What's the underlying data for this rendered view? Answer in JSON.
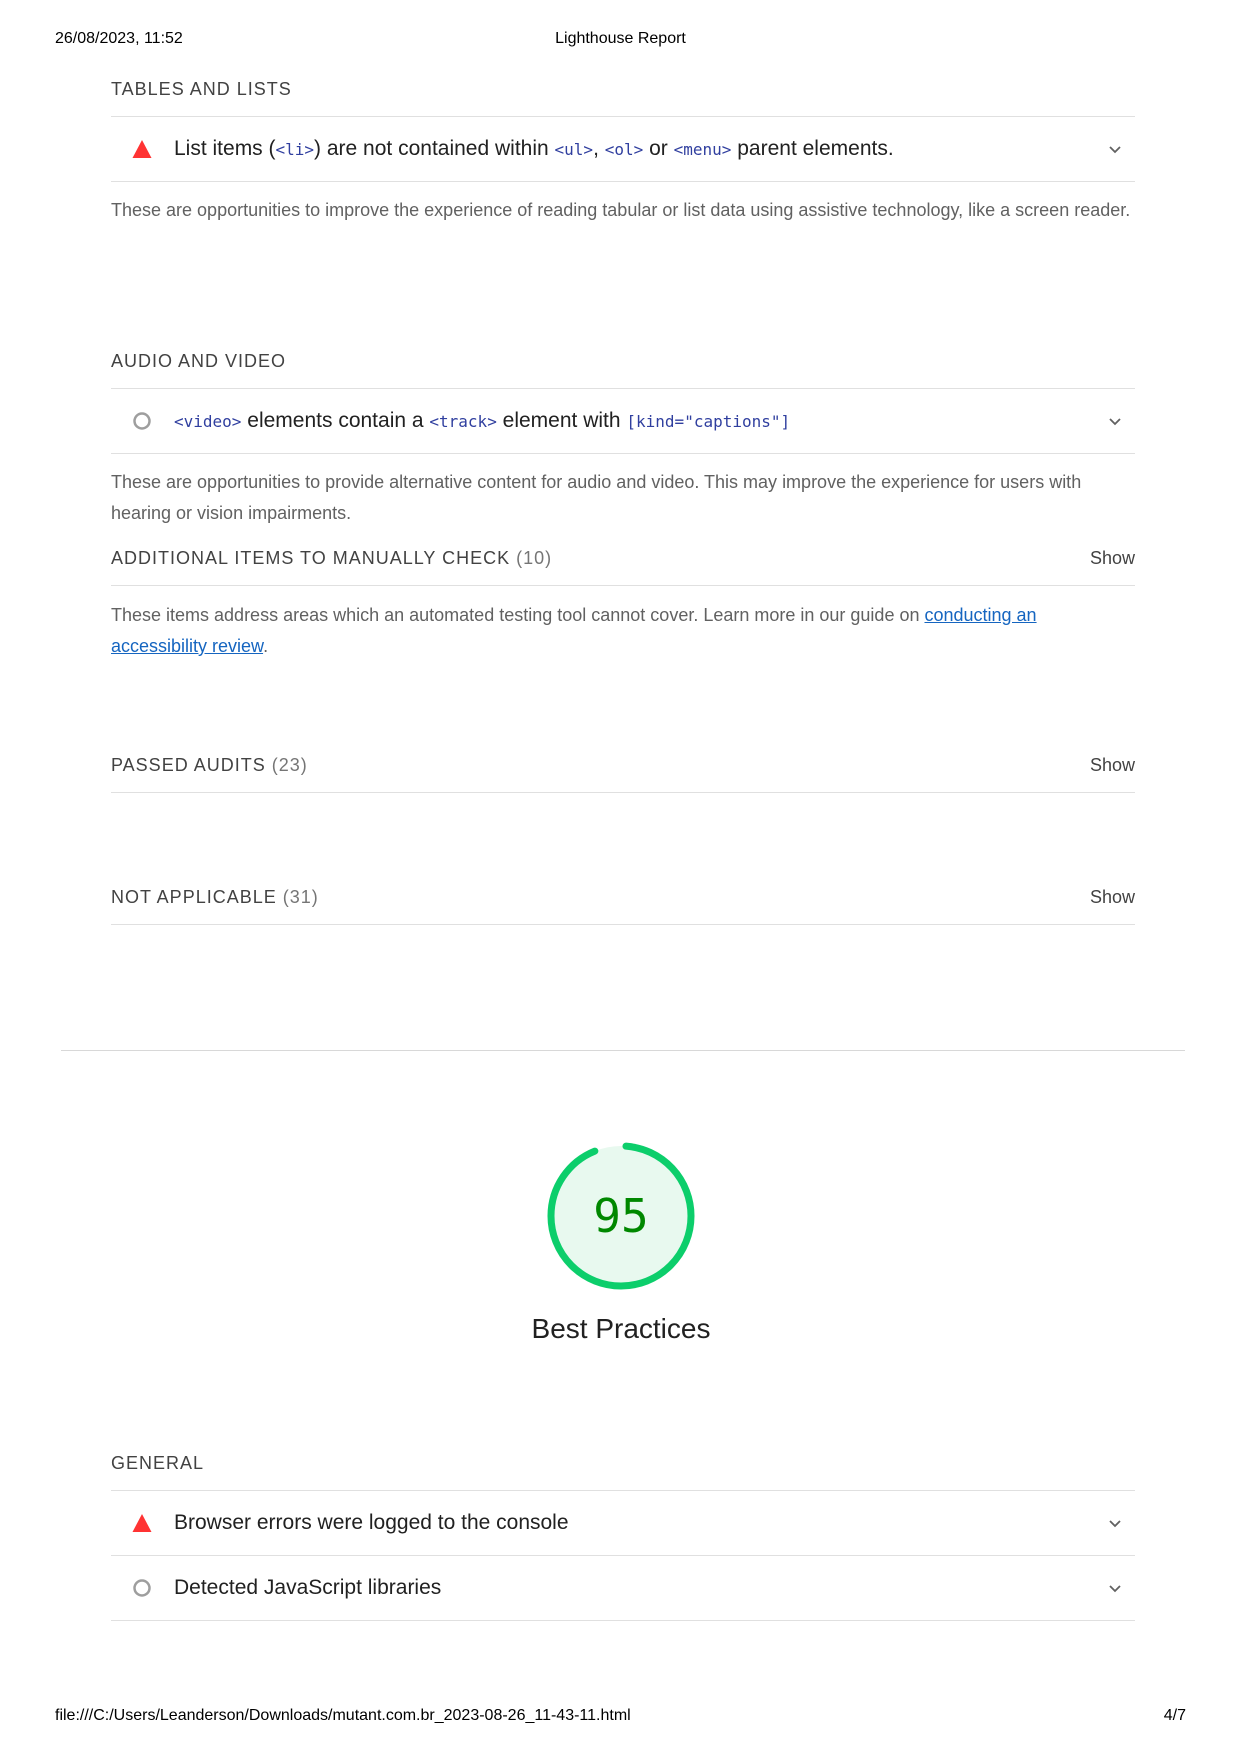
{
  "print_header": {
    "datetime": "26/08/2023, 11:52",
    "title": "Lighthouse Report"
  },
  "print_footer": {
    "path": "file:///C:/Users/Leanderson/Downloads/mutant.com.br_2023-08-26_11-43-11.html",
    "page": "4/7"
  },
  "tables_and_lists": {
    "title": "TABLES AND LISTS",
    "audit": {
      "icon": "fail-triangle-icon",
      "t1": "List items (",
      "c1": "<li>",
      "t2": ") are not contained within ",
      "c2": "<ul>",
      "t3": ", ",
      "c3": "<ol>",
      "t4": " or ",
      "c4": "<menu>",
      "t5": " parent elements."
    },
    "description": "These are opportunities to improve the experience of reading tabular or list data using assistive technology, like a screen reader."
  },
  "audio_and_video": {
    "title": "AUDIO AND VIDEO",
    "audit": {
      "icon": "informative-circle-icon",
      "c1": "<video>",
      "t1": " elements contain a ",
      "c2": "<track>",
      "t2": " element with ",
      "c3": "[kind=\"captions\"]"
    },
    "description": "These are opportunities to provide alternative content for audio and video. This may improve the experience for users with hearing or vision impairments."
  },
  "manual_check": {
    "title": "ADDITIONAL ITEMS TO MANUALLY CHECK",
    "count": "(10)",
    "show_label": "Show",
    "description_prefix": "These items address areas which an automated testing tool cannot cover. Learn more in our guide on ",
    "link_text": "conducting an accessibility review",
    "description_suffix": "."
  },
  "passed_audits": {
    "title": "PASSED AUDITS",
    "count": "(23)",
    "show_label": "Show"
  },
  "not_applicable": {
    "title": "NOT APPLICABLE",
    "count": "(31)",
    "show_label": "Show"
  },
  "best_practices": {
    "score": "95",
    "score_fraction": 0.95,
    "label": "Best Practices",
    "colors": {
      "ring": "#0cce6b",
      "fill": "#e8f9ef",
      "text": "#008800"
    }
  },
  "general": {
    "title": "GENERAL",
    "audits": [
      {
        "icon": "fail-triangle-icon",
        "title": "Browser errors were logged to the console"
      },
      {
        "icon": "informative-circle-icon",
        "title": "Detected JavaScript libraries"
      }
    ]
  },
  "colors": {
    "fail": "#ff3333",
    "informative": "#9e9e9e",
    "link": "#1565c0",
    "code": "#303f9f"
  }
}
